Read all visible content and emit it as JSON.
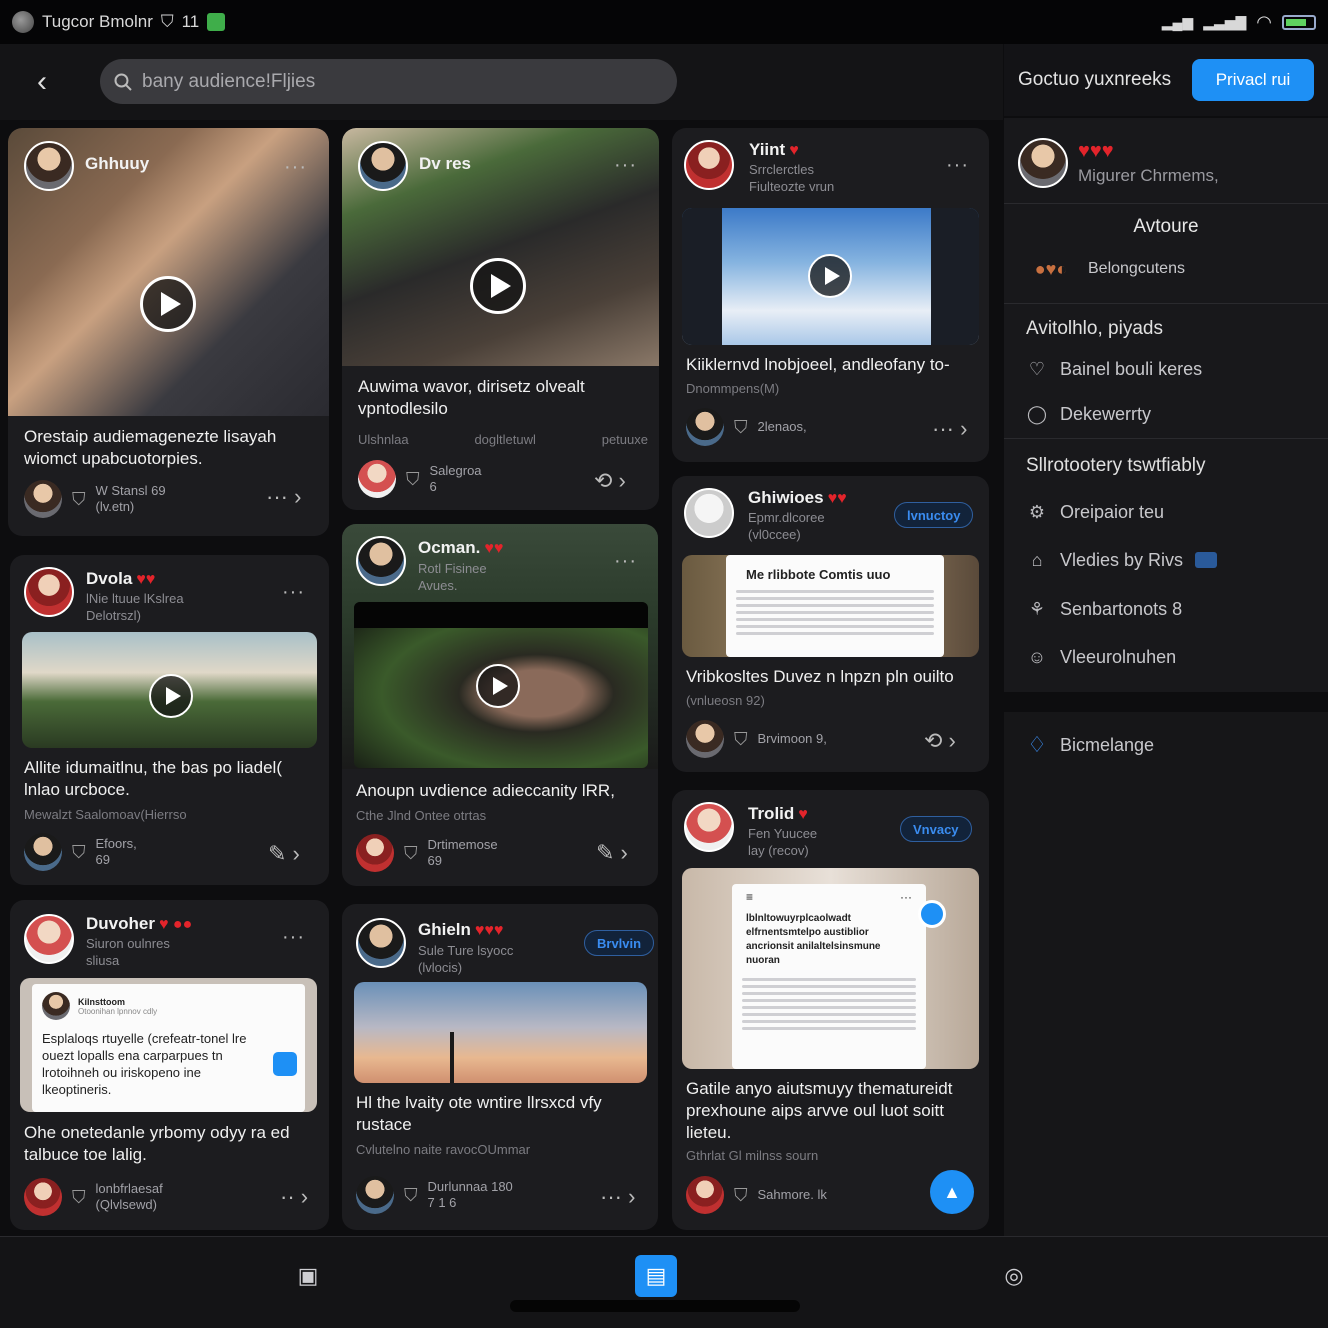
{
  "status": {
    "left_text": "Tugcor Bmolnr",
    "count": "11"
  },
  "search": {
    "placeholder": "bany audience!Fljies"
  },
  "right_header": {
    "title": "Goctuo yuxnreeks",
    "button": "Privacl rui"
  },
  "cards": {
    "c1": {
      "user": "Ghhuuy",
      "title": "Orestaip audiemagenezte lisayah wiomct upabcuotorpies.",
      "foot1": "W Stansl 69",
      "foot2": "(lv.etn)"
    },
    "c2": {
      "user": "Dv res",
      "title": "Auwima wavor, dirisetz olvealt vpntodlesilo",
      "meta1": "Ulshnlaa",
      "meta2": "dogltletuwl",
      "meta3": "petuuxe",
      "foot1": "Salegroa",
      "foot2": "6"
    },
    "c3": {
      "user": "Yiint",
      "meta1": "Srrclerctles",
      "meta2": "Fiulteozte vrun",
      "title": "Kiiklernvd lnobjoeel, andleofany to-",
      "sub": "Dnommpens(M)",
      "foot1": "2lenaos,"
    },
    "c4": {
      "user": "Dvola",
      "meta1": "lNie ltuue lKslrea",
      "meta2": "Delotrszl)",
      "title": "Allite idumaitlnu, the bas po liadel( lnlao urcboce.",
      "sub": "Mewalzt Saalomoav(Hierrso",
      "foot1": "Efoors,",
      "foot2": "69"
    },
    "c5": {
      "user": "Ocman.",
      "meta1": "Rotl Fisinee",
      "meta2": "Avues.",
      "title": "Anoupn uvdience adieccanity lRR,",
      "sub": "Cthe Jlnd Ontee otrtas",
      "foot1": "Drtimemose",
      "foot2": "69"
    },
    "c6": {
      "user": "Ghiwioes",
      "meta1": "Epmr.dlcoree",
      "meta2": "(vl0ccee)",
      "tag": "lvnuctoy",
      "doc_title": "Me rlibbote Comtis uuo",
      "title": "Vribkosltes Duvez n lnpzn pln ouilto",
      "sub": "(vnlueosn 92)",
      "foot1": "Brvimoon 9,"
    },
    "c7": {
      "user": "Duvoher",
      "meta1": "Siuron oulnres",
      "meta2": "sliusa",
      "post_user": "Kilnsttoom",
      "post_meta": "Otoonihan lpnnov cdly",
      "post_text": "Esplaloqs rtuyelle (crefeatr-tonel lre ouezt lopalls ena carparpues tn lrotoihneh ou iriskopeno ine lkeoptineris.",
      "title": "Ohe onetedanle yrbomy odyy ra ed talbuce toe lalig.",
      "foot1": "lonbfrlaesaf",
      "foot2": "(Qlvlsewd)"
    },
    "c8": {
      "user": "Ghieln",
      "meta1": "Sule Ture lsyocc",
      "meta2": "(lvlocis)",
      "tag": "Brvlvin",
      "title": "Hl the lvaity ote wntire llrsxcd vfy rustace",
      "sub": "Cvlutelno naite ravocOUmmar",
      "foot1": "Durlunnaa 180",
      "foot2": "7 1 6"
    },
    "c9": {
      "user": "Trolid",
      "meta1": "Fen Yuucee",
      "meta2": "lay (recov)",
      "tag": "Vnvacy",
      "doc_title": "lblnltowuyrplcaolwadt elfrnentsmtelpo austiblior ancrionsit anilaltelsinsmune nuoran",
      "title": "Gatile anyo aiutsmuyy thematureidt prexhoune aips arvve oul luot soitt lieteu.",
      "sub": "Gthrlat Gl milnss sourn",
      "foot1": "Sahmore. lk"
    }
  },
  "right_panel": {
    "profile_name": "Migurer Chrmems,",
    "section1": "Avtoure",
    "section1_item": "Belongcutens",
    "section2": "Avitolhlo, piyads",
    "section2_items": [
      "Bainel bouli keres",
      "Dekewerrty"
    ],
    "section3": "Sllrotootery tswtfiably",
    "section3_items": [
      "Oreipaior teu",
      "Vledies by Rivs",
      "Senbartonots 8",
      "Vleeurolnuhen"
    ],
    "bottom_item": "Bicmelange"
  },
  "colors": {
    "accent": "#1e90f5",
    "heart": "#e3242b"
  },
  "icons": {
    "back": "chevron-left-icon",
    "search": "search-icon"
  }
}
